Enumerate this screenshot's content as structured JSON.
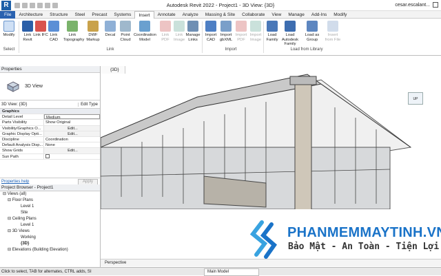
{
  "app": {
    "logo": "R",
    "title": "Autodesk Revit 2022 - Project1 - 3D View: {3D}",
    "user": "cesar.escalant..."
  },
  "tabs": [
    "File",
    "Architecture",
    "Structure",
    "Steel",
    "Precast",
    "Systems",
    "Insert",
    "Annotate",
    "Analyze",
    "Massing & Site",
    "Collaborate",
    "View",
    "Manage",
    "Add-Ins",
    "Modify"
  ],
  "ribbon": {
    "buttons": [
      "Modify",
      "Link Revit",
      "Link IFC",
      "Link CAD",
      "Link Topography",
      "DWF Markup",
      "Decal",
      "Point Cloud",
      "Coordination Model",
      "Link PDF",
      "Link Image",
      "Manage Links",
      "Import CAD",
      "Import gbXML",
      "Import PDF",
      "Import Image",
      "Load Family",
      "Load Autodesk Family",
      "Load as Group",
      "Insert from File"
    ],
    "panels": [
      "Select",
      "Link",
      "Import",
      "Load from Library"
    ]
  },
  "properties": {
    "header": "Properties",
    "type_name": "3D View",
    "view_selector": "3D View: {3D}",
    "edit_type": "Edit Type",
    "group": "Graphics",
    "rows": [
      {
        "k": "Detail Level",
        "v": "Medium"
      },
      {
        "k": "Parts Visibility",
        "v": "Show Original"
      },
      {
        "k": "Visibility/Graphics O...",
        "v": "Edit..."
      },
      {
        "k": "Graphic Display Opti...",
        "v": "Edit..."
      },
      {
        "k": "Discipline",
        "v": "Coordination"
      },
      {
        "k": "Default Analysis Disp...",
        "v": "None"
      },
      {
        "k": "Show Grids",
        "v": "Edit..."
      },
      {
        "k": "Sun Path",
        "v": ""
      }
    ],
    "help": "Properties help",
    "apply": "Apply"
  },
  "browser": {
    "header": "Project Browser - Project1",
    "items": [
      "Views (all)",
      "Floor Plans",
      "Level 1",
      "Site",
      "Ceiling Plans",
      "Level 1",
      "3D Views",
      "Working",
      "{3D}",
      "Elevations (Building Elevation)"
    ]
  },
  "view": {
    "tab": "{3D}",
    "cube_label": "UP",
    "bar": "Perspective"
  },
  "status": {
    "text": "Click to select, TAB for alternates, CTRL adds, SI",
    "model": "Main Model"
  },
  "watermark": {
    "title": "PHANMEMMAYTINH.VN",
    "subtitle": "Bảo Mật - An Toàn - Tiện Lợi"
  },
  "colors": {
    "accent": "#2a62b0",
    "watermark": "#1a73c8"
  }
}
